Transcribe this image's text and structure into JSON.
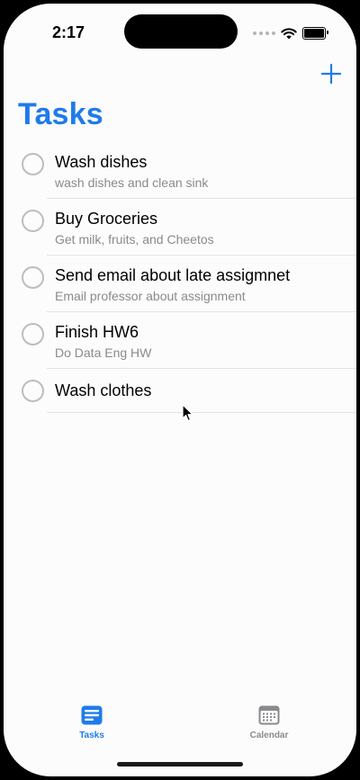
{
  "status_bar": {
    "time": "2:17"
  },
  "header": {
    "title": "Tasks",
    "add_icon": "plus-icon"
  },
  "tasks": [
    {
      "title": "Wash dishes",
      "note": "wash dishes and clean sink"
    },
    {
      "title": "Buy Groceries",
      "note": "Get milk, fruits, and Cheetos"
    },
    {
      "title": "Send email about late assigmnet",
      "note": "Email professor about assignment"
    },
    {
      "title": "Finish HW6",
      "note": "Do Data Eng HW"
    },
    {
      "title": "Wash clothes",
      "note": ""
    }
  ],
  "tab_bar": {
    "tasks_label": "Tasks",
    "calendar_label": "Calendar",
    "active": "Tasks"
  },
  "colors": {
    "accent": "#1f7bea",
    "secondary_text": "#8a8a8e",
    "separator": "#e3e3e3"
  }
}
